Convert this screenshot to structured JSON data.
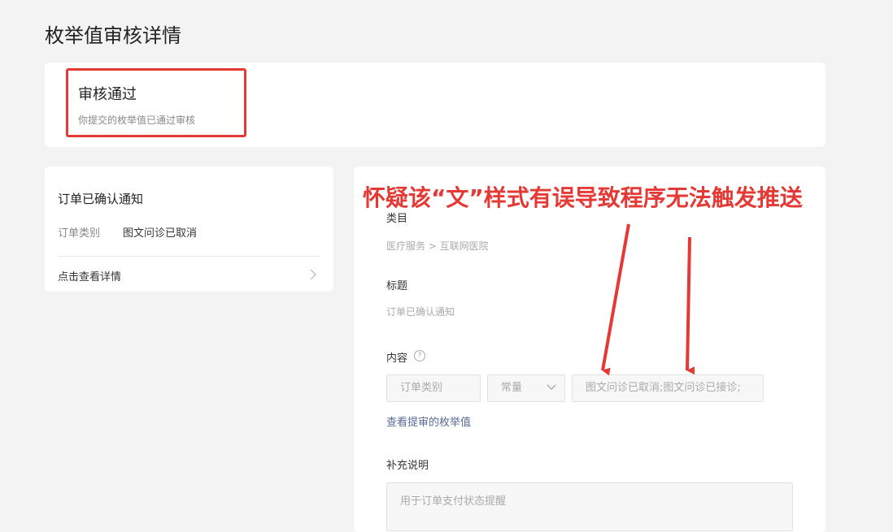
{
  "page": {
    "title": "枚举值审核详情"
  },
  "status": {
    "title": "审核通过",
    "description": "你提交的枚举值已通过审核"
  },
  "preview": {
    "title": "订单已确认通知",
    "row_key": "订单类别",
    "row_value": "图文问诊已取消",
    "link": "点击查看详情"
  },
  "detail": {
    "category_label": "类目",
    "category_value": "医疗服务 > 互联网医院",
    "title_label": "标题",
    "title_value": "订单已确认通知",
    "content_label": "内容",
    "help_glyph": "?",
    "field_key": "订单类别",
    "field_type": "常量",
    "field_value": "图文问诊已取消;图文问诊已接诊;",
    "view_enum_link": "查看提审的枚举值",
    "note_label": "补充说明",
    "note_placeholder": "用于订单支付状态提醒"
  },
  "annotation": {
    "text": "怀疑该“文”样式有误导致程序无法触发推送",
    "color": "#e53935"
  },
  "colors": {
    "highlight": "#e53935",
    "link": "#576b95"
  }
}
